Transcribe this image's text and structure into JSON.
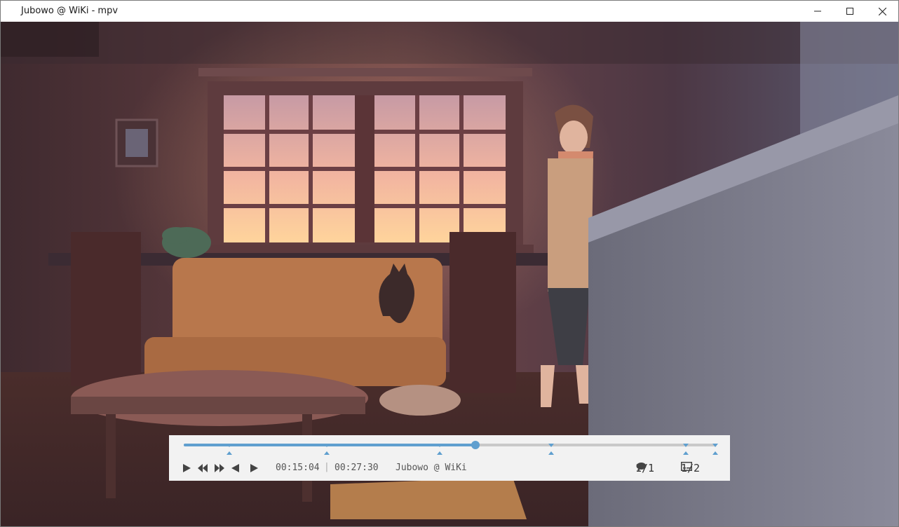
{
  "window": {
    "title": "Jubowo @ WiKi - mpv",
    "icons": {
      "minimize": "minimize-icon",
      "maximize": "maximize-icon",
      "close": "close-icon"
    }
  },
  "player": {
    "playback": {
      "current_time": "00:15:04",
      "separator": "|",
      "total_time": "00:27:30",
      "progress_fraction": 0.548
    },
    "media_title": "Jubowo @ WiKi",
    "chapter_fractions": [
      0.086,
      0.268,
      0.48,
      0.69,
      0.942,
      0.997
    ],
    "controls": {
      "play": "play-icon",
      "rewind": "rewind-icon",
      "fast_forward": "fast-forward-icon",
      "prev_frame": "previous-icon",
      "next_frame": "next-icon"
    },
    "audio_track": {
      "icon": "speech-bubble-icon",
      "value": "1/1"
    },
    "subtitle_track": {
      "icon": "subtitles-icon",
      "value": "1/2"
    },
    "accent_color": "#5f9fcf"
  }
}
